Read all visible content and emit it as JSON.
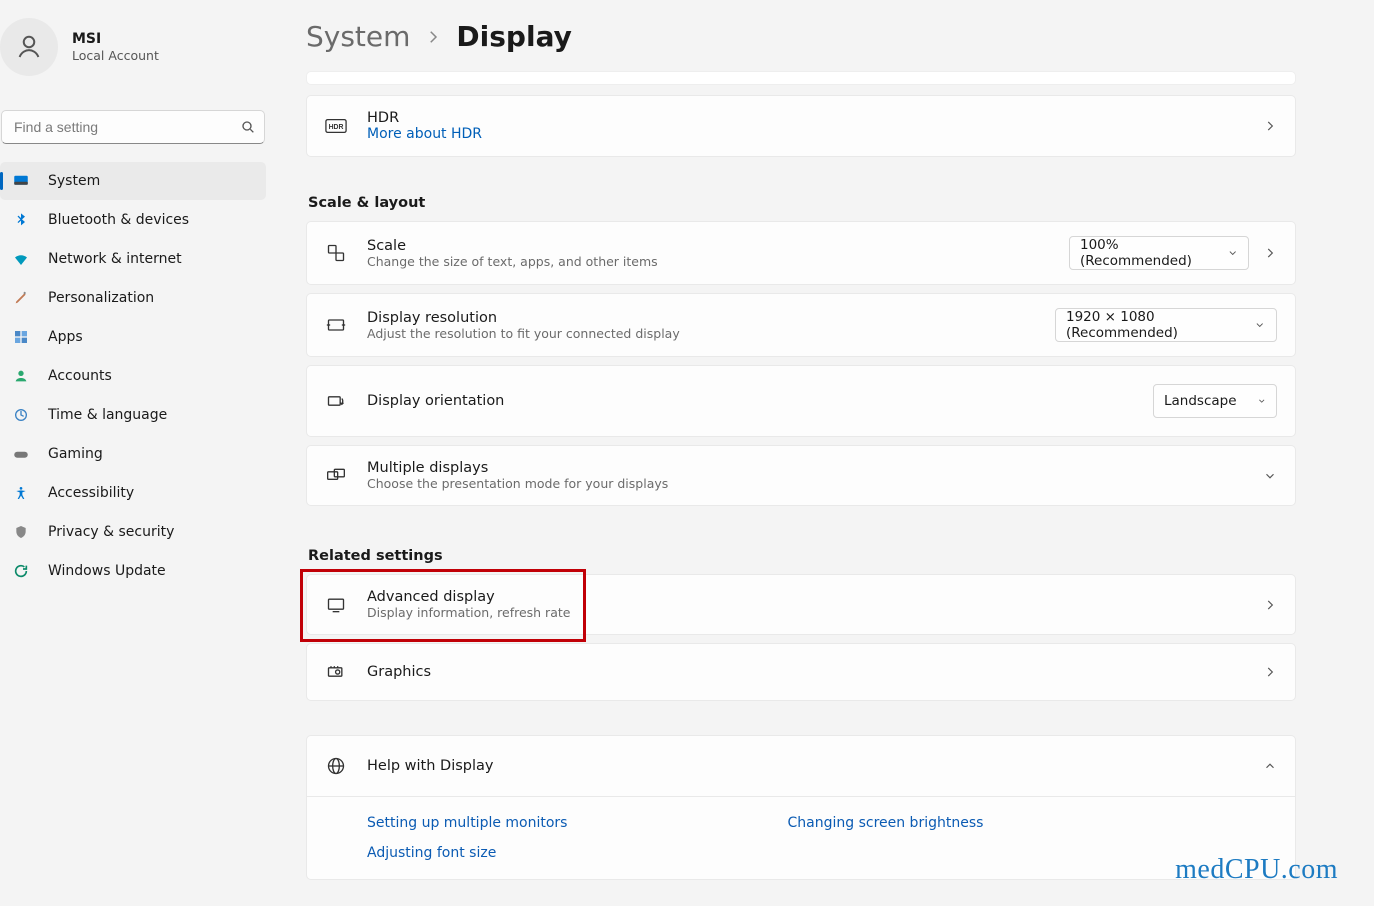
{
  "profile": {
    "name": "MSI",
    "subtitle": "Local Account"
  },
  "search": {
    "placeholder": "Find a setting"
  },
  "nav": {
    "items": [
      {
        "label": "System"
      },
      {
        "label": "Bluetooth & devices"
      },
      {
        "label": "Network & internet"
      },
      {
        "label": "Personalization"
      },
      {
        "label": "Apps"
      },
      {
        "label": "Accounts"
      },
      {
        "label": "Time & language"
      },
      {
        "label": "Gaming"
      },
      {
        "label": "Accessibility"
      },
      {
        "label": "Privacy & security"
      },
      {
        "label": "Windows Update"
      }
    ]
  },
  "breadcrumb": {
    "root": "System",
    "current": "Display"
  },
  "hdr": {
    "title": "HDR",
    "link": "More about HDR"
  },
  "sections": {
    "scale_layout": "Scale & layout",
    "related": "Related settings"
  },
  "scale": {
    "title": "Scale",
    "sub": "Change the size of text, apps, and other items",
    "value": "100% (Recommended)"
  },
  "resolution": {
    "title": "Display resolution",
    "sub": "Adjust the resolution to fit your connected display",
    "value": "1920 × 1080 (Recommended)"
  },
  "orientation": {
    "title": "Display orientation",
    "value": "Landscape"
  },
  "multiple": {
    "title": "Multiple displays",
    "sub": "Choose the presentation mode for your displays"
  },
  "advanced": {
    "title": "Advanced display",
    "sub": "Display information, refresh rate"
  },
  "graphics": {
    "title": "Graphics"
  },
  "help": {
    "title": "Help with Display",
    "links": {
      "a": "Setting up multiple monitors",
      "b": "Adjusting font size",
      "c": "Changing screen brightness"
    }
  },
  "watermark": "medCPU.com"
}
